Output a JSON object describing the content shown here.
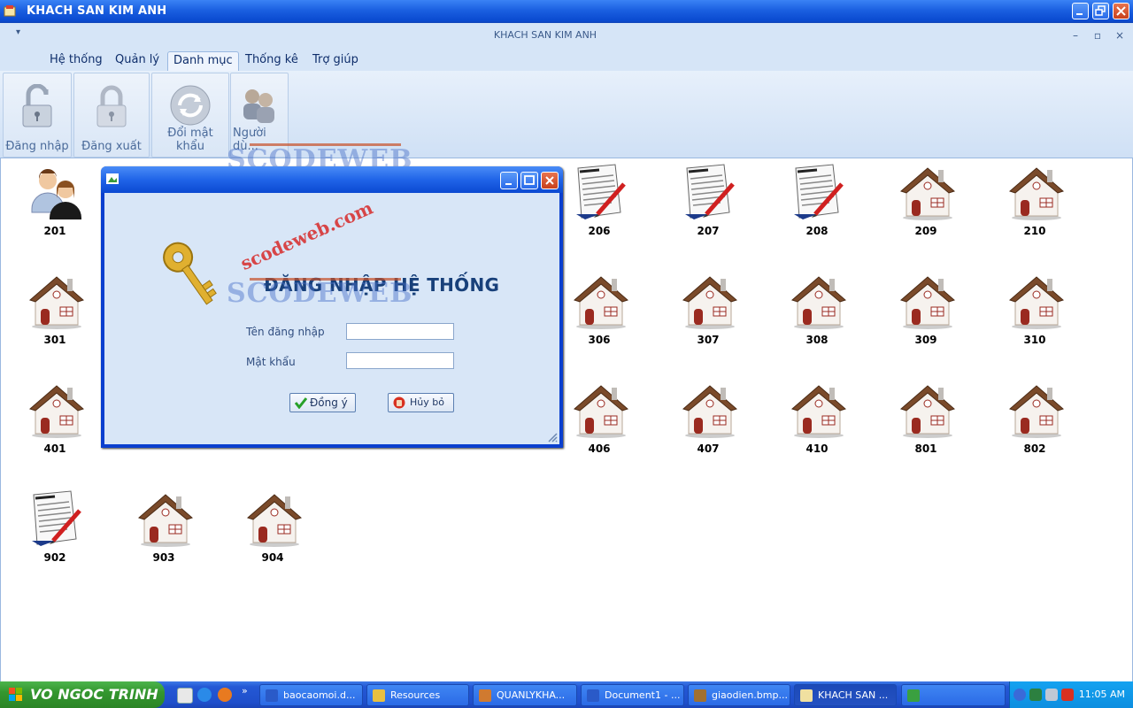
{
  "window": {
    "title": "KHACH SAN KIM ANH",
    "mdi_title": "KHACH SAN KIM ANH",
    "quick_access": "▾"
  },
  "menu_tabs": [
    {
      "label": "Hệ thống"
    },
    {
      "label": "Quản lý"
    },
    {
      "label": "Danh mục"
    },
    {
      "label": "Thống kê"
    },
    {
      "label": "Trợ giúp"
    }
  ],
  "ribbon_buttons": [
    {
      "label": "Đăng nhập",
      "icon": "unlock-icon"
    },
    {
      "label": "Đăng xuất",
      "icon": "lock-icon"
    },
    {
      "label": "Đổi mật khẩu",
      "icon": "refresh-icon"
    },
    {
      "label": "Người dù...",
      "icon": "users-icon"
    }
  ],
  "rooms": [
    {
      "number": "201",
      "icon": "guests-icon"
    },
    {
      "number": "206",
      "icon": "document-icon"
    },
    {
      "number": "207",
      "icon": "document-icon"
    },
    {
      "number": "208",
      "icon": "document-icon"
    },
    {
      "number": "209",
      "icon": "house-icon"
    },
    {
      "number": "210",
      "icon": "house-icon"
    },
    {
      "number": "301",
      "icon": "house-icon"
    },
    {
      "number": "306",
      "icon": "house-icon"
    },
    {
      "number": "307",
      "icon": "house-icon"
    },
    {
      "number": "308",
      "icon": "house-icon"
    },
    {
      "number": "309",
      "icon": "house-icon"
    },
    {
      "number": "310",
      "icon": "house-icon"
    },
    {
      "number": "401",
      "icon": "house-icon"
    },
    {
      "number": "406",
      "icon": "house-icon"
    },
    {
      "number": "407",
      "icon": "house-icon"
    },
    {
      "number": "410",
      "icon": "house-icon"
    },
    {
      "number": "801",
      "icon": "house-icon"
    },
    {
      "number": "802",
      "icon": "house-icon"
    },
    {
      "number": "902",
      "icon": "document-icon"
    },
    {
      "number": "903",
      "icon": "house-icon"
    },
    {
      "number": "904",
      "icon": "house-icon"
    }
  ],
  "login_dialog": {
    "heading": "ĐĂNG NHẬP HỆ THỐNG",
    "username_label": "Tên đăng nhập",
    "username_value": "",
    "password_label": "Mật khẩu",
    "password_value": "",
    "ok_label": "Đồng ý",
    "cancel_label": "Hủy bỏ"
  },
  "watermark": {
    "brand": "SCODEWEB",
    "url": "scodeweb.com"
  },
  "taskbar": {
    "start_label": "VO NGOC TRINH",
    "items": [
      {
        "label": "baocaomoi.d..."
      },
      {
        "label": "Resources"
      },
      {
        "label": "QUANLYKHA..."
      },
      {
        "label": "Document1 - ..."
      },
      {
        "label": "giaodien.bmp..."
      },
      {
        "label": "KHACH SAN ..."
      }
    ],
    "clock": "11:05 AM"
  },
  "colors": {
    "xp_blue": "#1a5fe0",
    "ribbon_bg": "#d6e5f7",
    "start_green": "#34972f",
    "close_red": "#c7401c"
  }
}
